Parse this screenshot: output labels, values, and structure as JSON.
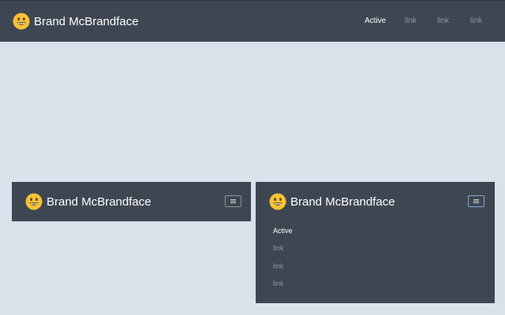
{
  "brand": {
    "name": "Brand McBrandface",
    "icon": "smiley-face-icon"
  },
  "nav": {
    "links": [
      {
        "label": "Active",
        "active": true
      },
      {
        "label": "link",
        "active": false
      },
      {
        "label": "link",
        "active": false
      },
      {
        "label": "link",
        "active": false
      }
    ]
  },
  "colors": {
    "page_background": "#dae1ea",
    "navbar_background": "#3e4751",
    "active_link": "#ffffff",
    "inactive_link": "#8d949c",
    "toggler_focus_border": "#7fa8d8",
    "smiley_face": "#f6c235"
  },
  "toggler": {
    "icon": "hamburger-menu-icon"
  }
}
